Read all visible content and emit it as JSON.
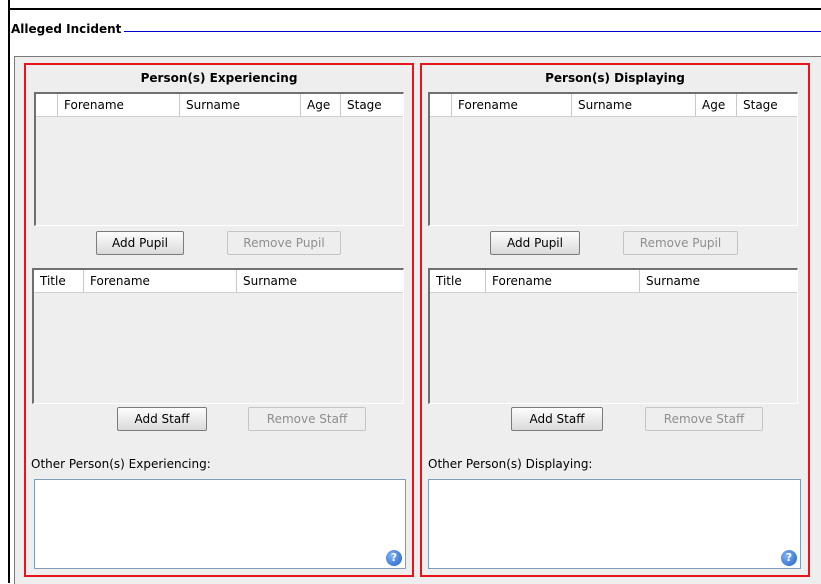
{
  "legend": "Alleged Incident",
  "panels": {
    "experiencing": {
      "title": "Person(s) Experiencing",
      "pupil_columns": [
        "Forename",
        "Surname",
        "Age",
        "Stage"
      ],
      "add_pupil": "Add Pupil",
      "remove_pupil": "Remove Pupil",
      "staff_columns": [
        "Title",
        "Forename",
        "Surname"
      ],
      "add_staff": "Add Staff",
      "remove_staff": "Remove Staff",
      "other_label": "Other Person(s) Experiencing:",
      "help_glyph": "?"
    },
    "displaying": {
      "title": "Person(s) Displaying",
      "pupil_columns": [
        "Forename",
        "Surname",
        "Age",
        "Stage"
      ],
      "add_pupil": "Add Pupil",
      "remove_pupil": "Remove Pupil",
      "staff_columns": [
        "Title",
        "Forename",
        "Surname"
      ],
      "add_staff": "Add Staff",
      "remove_staff": "Remove Staff",
      "other_label": "Other Person(s) Displaying:",
      "help_glyph": "?"
    }
  },
  "colors": {
    "panel_border": "#e8141b",
    "legend_line": "#0000cc"
  }
}
